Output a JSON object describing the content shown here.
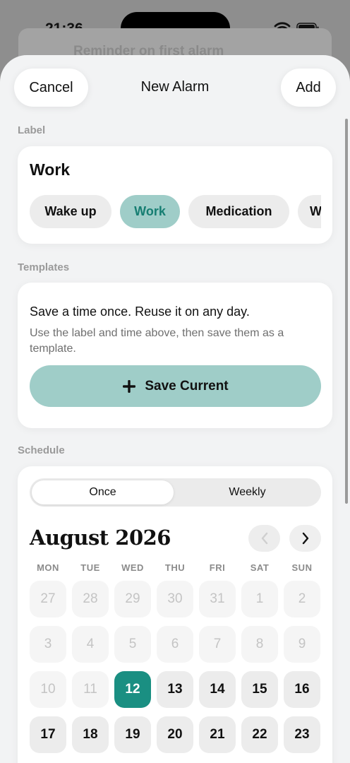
{
  "status_bar": {
    "time": "21:36",
    "dots": "••••"
  },
  "background": {
    "hint_text": "Reminder on first alarm"
  },
  "header": {
    "cancel_label": "Cancel",
    "title": "New Alarm",
    "add_label": "Add"
  },
  "label_section": {
    "heading": "Label",
    "value": "Work",
    "chips": [
      {
        "label": "Wake up",
        "selected": false
      },
      {
        "label": "Work",
        "selected": true
      },
      {
        "label": "Medication",
        "selected": false
      },
      {
        "label": "W",
        "selected": false
      }
    ]
  },
  "templates_section": {
    "heading": "Templates",
    "headline": "Save a time once. Reuse it on any day.",
    "description": "Use the label and time above, then save them as a template.",
    "save_label": "Save Current",
    "save_icon": "plus-icon"
  },
  "schedule_section": {
    "heading": "Schedule",
    "segments": [
      "Once",
      "Weekly"
    ],
    "selected_segment": "Once",
    "month_label": "August 2026",
    "prev_icon": "chevron-left-icon",
    "next_icon": "chevron-right-icon",
    "weekdays": [
      "MON",
      "TUE",
      "WED",
      "THU",
      "FRI",
      "SAT",
      "SUN"
    ],
    "days": [
      {
        "label": "27",
        "state": "muted"
      },
      {
        "label": "28",
        "state": "muted"
      },
      {
        "label": "29",
        "state": "muted"
      },
      {
        "label": "30",
        "state": "muted"
      },
      {
        "label": "31",
        "state": "muted"
      },
      {
        "label": "1",
        "state": "muted"
      },
      {
        "label": "2",
        "state": "muted"
      },
      {
        "label": "3",
        "state": "muted"
      },
      {
        "label": "4",
        "state": "muted"
      },
      {
        "label": "5",
        "state": "muted"
      },
      {
        "label": "6",
        "state": "muted"
      },
      {
        "label": "7",
        "state": "muted"
      },
      {
        "label": "8",
        "state": "muted"
      },
      {
        "label": "9",
        "state": "muted"
      },
      {
        "label": "10",
        "state": "muted"
      },
      {
        "label": "11",
        "state": "muted"
      },
      {
        "label": "12",
        "state": "selected"
      },
      {
        "label": "13",
        "state": "active"
      },
      {
        "label": "14",
        "state": "active"
      },
      {
        "label": "15",
        "state": "active"
      },
      {
        "label": "16",
        "state": "active"
      },
      {
        "label": "17",
        "state": "active"
      },
      {
        "label": "18",
        "state": "active"
      },
      {
        "label": "19",
        "state": "active"
      },
      {
        "label": "20",
        "state": "active"
      },
      {
        "label": "21",
        "state": "active"
      },
      {
        "label": "22",
        "state": "active"
      },
      {
        "label": "23",
        "state": "active"
      }
    ]
  },
  "colors": {
    "accent": "#1a8f82",
    "chip_selected": "#9fcdc8",
    "sheet": "#f2f3f4"
  }
}
